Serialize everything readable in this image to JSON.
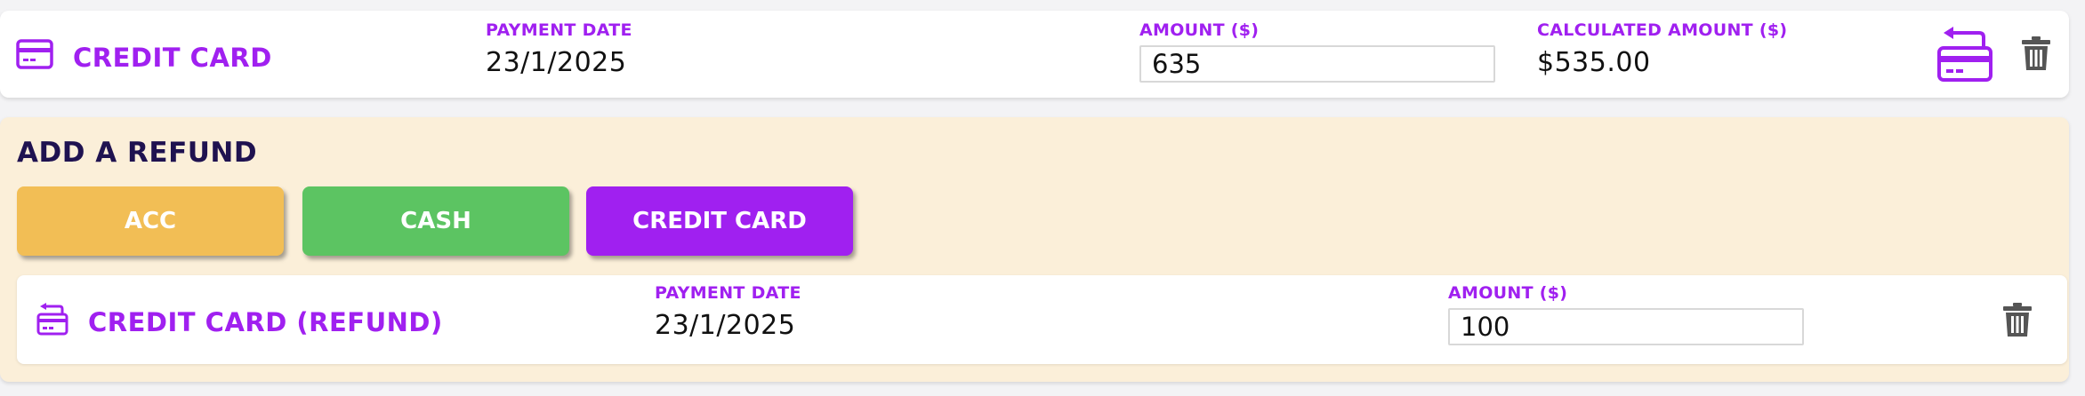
{
  "payment": {
    "method_label": "CREDIT CARD",
    "payment_date_label": "PAYMENT DATE",
    "payment_date": "23/1/2025",
    "amount_label": "AMOUNT ($)",
    "amount": "635",
    "calculated_label": "CALCULATED AMOUNT ($)",
    "calculated_amount": "$535.00",
    "icons": [
      "credit-card-icon",
      "refund-card-icon",
      "trash-icon"
    ]
  },
  "refund": {
    "title": "ADD A REFUND",
    "buttons": [
      {
        "label": "ACC",
        "color": "#f2be55"
      },
      {
        "label": "CASH",
        "color": "#5cc462"
      },
      {
        "label": "CREDIT CARD",
        "color": "#a020f0"
      }
    ],
    "entry": {
      "method_label": "CREDIT CARD (REFUND)",
      "payment_date_label": "PAYMENT DATE",
      "payment_date": "23/1/2025",
      "amount_label": "AMOUNT ($)",
      "amount": "100",
      "icons": [
        "refund-card-icon",
        "trash-icon"
      ]
    }
  },
  "colors": {
    "accent": "#a020f0",
    "refund_bg": "#fbefd9",
    "title": "#1f1250",
    "icon_gray": "#555555"
  }
}
